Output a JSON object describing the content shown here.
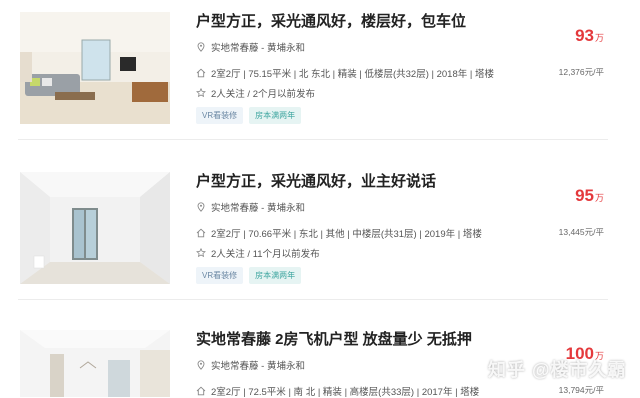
{
  "listings": [
    {
      "title": "户型方正，采光通风好，楼层好，包车位",
      "community": "实地常春藤 - 黄埔永和",
      "info": "2室2厅 | 75.15平米 | 北 东北 | 精装 | 低楼层(共32层) | 2018年 | 塔楼",
      "follow": "2人关注 / 2个月以前发布",
      "tags": [
        "VR看装修",
        "房本满两年"
      ],
      "price": "93",
      "price_unit": "万",
      "unit_price": "12,376元/平"
    },
    {
      "title": "户型方正，采光通风好，业主好说话",
      "community": "实地常春藤 - 黄埔永和",
      "info": "2室2厅 | 70.66平米 | 东北 | 其他 | 中楼层(共31层) | 2019年 | 塔楼",
      "follow": "2人关注 / 11个月以前发布",
      "tags": [
        "VR看装修",
        "房本满两年"
      ],
      "price": "95",
      "price_unit": "万",
      "unit_price": "13,445元/平"
    },
    {
      "title": "实地常春藤 2房飞机户型 放盘量少 无抵押",
      "community": "实地常春藤 - 黄埔永和",
      "info": "2室2厅 | 72.5平米 | 南 北 | 精装 | 高楼层(共33层) | 2017年 | 塔楼",
      "price": "100",
      "price_unit": "万",
      "unit_price": "13,794元/平"
    }
  ],
  "watermark": "知乎 @楼市久霸",
  "colors": {
    "price": "#e4393c",
    "tag_text": "#6a87a3",
    "tag_green": "#3fa6a0"
  },
  "icons": {
    "community": "location-pin-icon",
    "info": "house-icon",
    "follow": "star-icon"
  }
}
